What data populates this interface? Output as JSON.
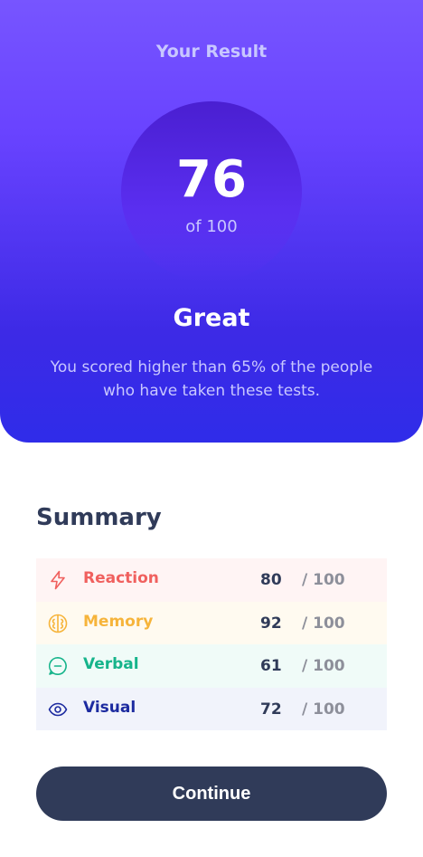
{
  "result": {
    "heading": "Your Result",
    "score": "76",
    "total": "of 100",
    "grade": "Great",
    "description": "You scored higher than 65% of the people who have taken these tests."
  },
  "summary": {
    "title": "Summary",
    "items": [
      {
        "label": "Reaction",
        "score": "80",
        "total": "/ 100",
        "icon": "lightning-icon",
        "color": "#f0605e",
        "bg": "#fff4f4"
      },
      {
        "label": "Memory",
        "score": "92",
        "total": "/ 100",
        "icon": "brain-icon",
        "color": "#f6b43b",
        "bg": "#fffaf0"
      },
      {
        "label": "Verbal",
        "score": "61",
        "total": "/ 100",
        "icon": "chat-bubble-icon",
        "color": "#16b48b",
        "bg": "#f0fbf8"
      },
      {
        "label": "Visual",
        "score": "72",
        "total": "/ 100",
        "icon": "eye-icon",
        "color": "#1d2ba0",
        "bg": "#f1f3fb"
      }
    ]
  },
  "actions": {
    "continue_label": "Continue"
  },
  "colors": {
    "gradient_top": "#7755ff",
    "gradient_bottom": "#2f2ce9",
    "dark_navy": "#303b59"
  }
}
